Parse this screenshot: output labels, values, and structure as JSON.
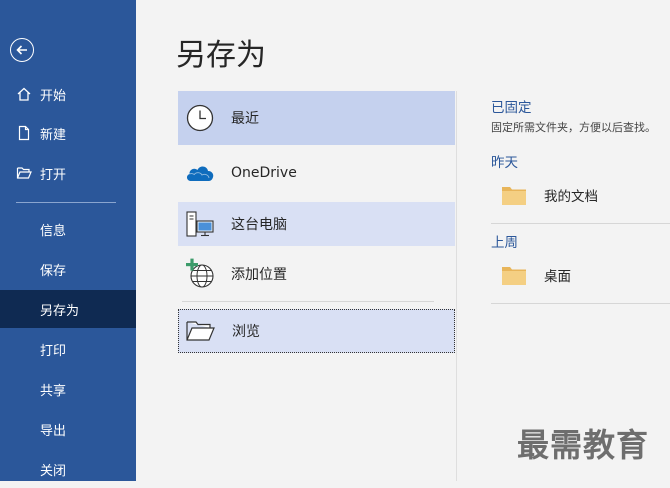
{
  "sidebar": {
    "items": [
      {
        "label": "开始",
        "icon": "home-icon"
      },
      {
        "label": "新建",
        "icon": "new-document-icon"
      },
      {
        "label": "打开",
        "icon": "open-folder-icon"
      },
      {
        "label": "信息"
      },
      {
        "label": "保存"
      },
      {
        "label": "另存为",
        "active": true
      },
      {
        "label": "打印"
      },
      {
        "label": "共享"
      },
      {
        "label": "导出"
      },
      {
        "label": "关闭"
      }
    ]
  },
  "page": {
    "title": "另存为"
  },
  "locations": [
    {
      "label": "最近",
      "icon": "clock-icon"
    },
    {
      "label": "OneDrive",
      "icon": "onedrive-cloud-icon"
    },
    {
      "label": "这台电脑",
      "icon": "computer-icon"
    },
    {
      "label": "添加位置",
      "icon": "add-location-icon"
    },
    {
      "label": "浏览",
      "icon": "browse-folder-icon"
    }
  ],
  "recent": {
    "pinned_title": "已固定",
    "pinned_desc": "固定所需文件夹，方便以后查找。",
    "yesterday_title": "昨天",
    "yesterday_folders": [
      "我的文档"
    ],
    "lastweek_title": "上周",
    "lastweek_folders": [
      "桌面"
    ]
  },
  "watermark": "最需教育",
  "colors": {
    "sidebar": "#2b579a",
    "sidebar_active": "#0f2a52",
    "selected": "#c5d1ee",
    "hover": "#d9e0f4",
    "folder": "#f2c979"
  }
}
